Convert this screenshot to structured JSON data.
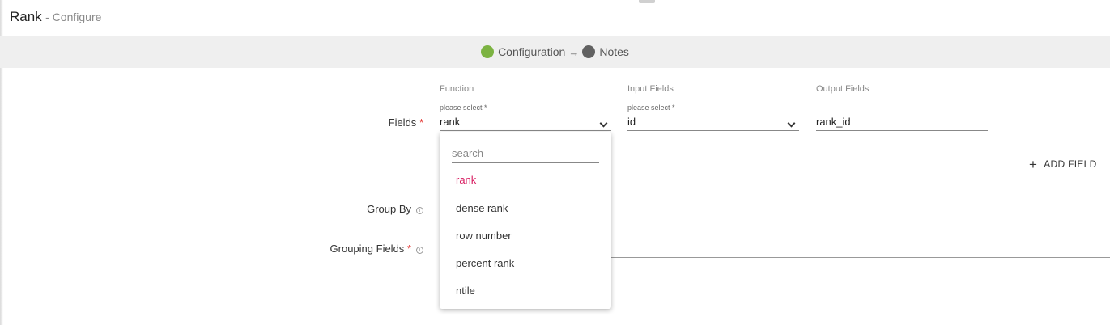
{
  "header": {
    "title": "Rank",
    "subtitle": "- Configure"
  },
  "stepper": {
    "steps": [
      {
        "label": "Configuration",
        "status_color": "#7cb342"
      },
      {
        "label": "Notes",
        "status_color": "#616161"
      }
    ],
    "separator": "→"
  },
  "fields_section": {
    "label": "Fields",
    "required_mark": "*",
    "columns": {
      "function": "Function",
      "input": "Input Fields",
      "output": "Output Fields"
    },
    "function_select": {
      "hint": "please select *",
      "value": "rank"
    },
    "input_select": {
      "hint": "please select *",
      "value": "id"
    },
    "output_field": {
      "value": "rank_id"
    },
    "add_field_label": "ADD FIELD",
    "add_icon": "+"
  },
  "group_by": {
    "label": "Group By",
    "info_icon": "i"
  },
  "grouping_fields": {
    "label": "Grouping Fields",
    "required_mark": "*",
    "info_icon": "i"
  },
  "dropdown": {
    "search_placeholder": "search",
    "options": [
      "rank",
      "dense rank",
      "row number",
      "percent rank",
      "ntile"
    ],
    "selected": "rank",
    "accent_color": "#d81b60"
  }
}
